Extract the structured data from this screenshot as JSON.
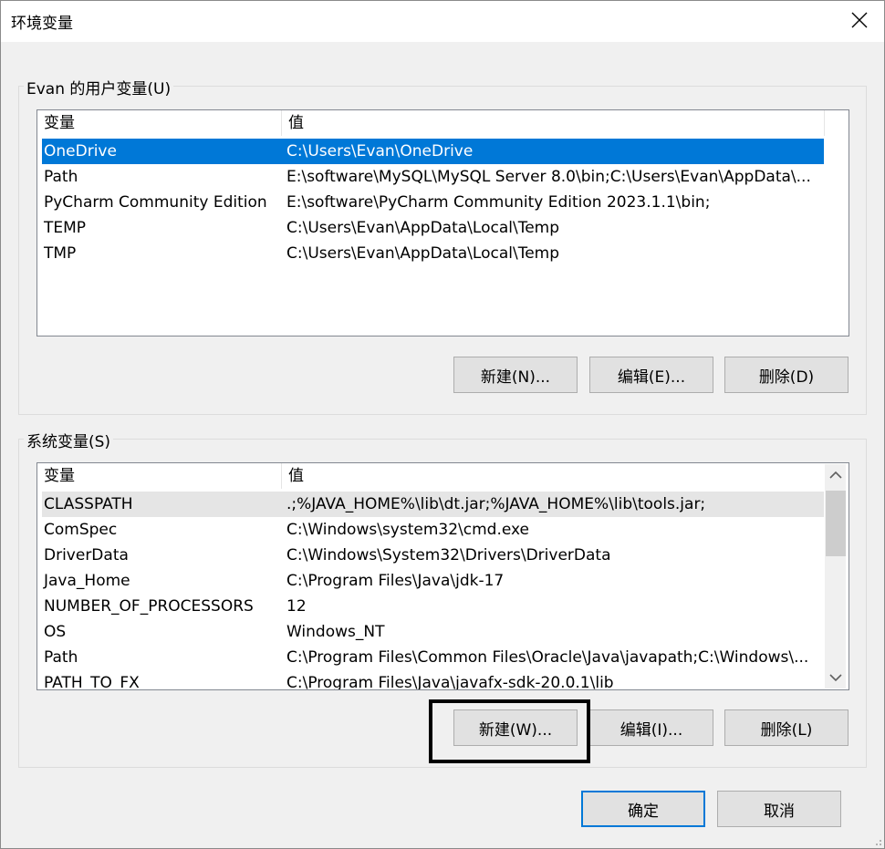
{
  "window": {
    "title": "环境变量",
    "close_glyph": "✕"
  },
  "user_vars": {
    "group_label": "Evan 的用户变量(U)",
    "header_name": "变量",
    "header_value": "值",
    "rows": [
      {
        "name": "OneDrive",
        "value": "C:\\Users\\Evan\\OneDrive"
      },
      {
        "name": "Path",
        "value": "E:\\software\\MySQL\\MySQL Server 8.0\\bin;C:\\Users\\Evan\\AppData\\..."
      },
      {
        "name": "PyCharm Community Edition",
        "value": "E:\\software\\PyCharm Community Edition 2023.1.1\\bin;"
      },
      {
        "name": "TEMP",
        "value": "C:\\Users\\Evan\\AppData\\Local\\Temp"
      },
      {
        "name": "TMP",
        "value": "C:\\Users\\Evan\\AppData\\Local\\Temp"
      }
    ],
    "buttons": {
      "new": "新建(N)...",
      "edit": "编辑(E)...",
      "delete": "删除(D)"
    }
  },
  "system_vars": {
    "group_label": "系统变量(S)",
    "header_name": "变量",
    "header_value": "值",
    "rows": [
      {
        "name": "CLASSPATH",
        "value": ".;%JAVA_HOME%\\lib\\dt.jar;%JAVA_HOME%\\lib\\tools.jar;"
      },
      {
        "name": "ComSpec",
        "value": "C:\\Windows\\system32\\cmd.exe"
      },
      {
        "name": "DriverData",
        "value": "C:\\Windows\\System32\\Drivers\\DriverData"
      },
      {
        "name": "Java_Home",
        "value": "C:\\Program Files\\Java\\jdk-17"
      },
      {
        "name": "NUMBER_OF_PROCESSORS",
        "value": "12"
      },
      {
        "name": "OS",
        "value": "Windows_NT"
      },
      {
        "name": "Path",
        "value": "C:\\Program Files\\Common Files\\Oracle\\Java\\javapath;C:\\Windows\\..."
      },
      {
        "name": "PATH_TO_FX",
        "value": "C:\\Program Files\\Java\\javafx-sdk-20.0.1\\lib"
      }
    ],
    "buttons": {
      "new": "新建(W)...",
      "edit": "编辑(I)...",
      "delete": "删除(L)"
    }
  },
  "footer": {
    "ok": "确定",
    "cancel": "取消"
  },
  "colors": {
    "selection": "#0078d7",
    "primary_border": "#0078d7",
    "hover_row": "#e5e5e5"
  }
}
